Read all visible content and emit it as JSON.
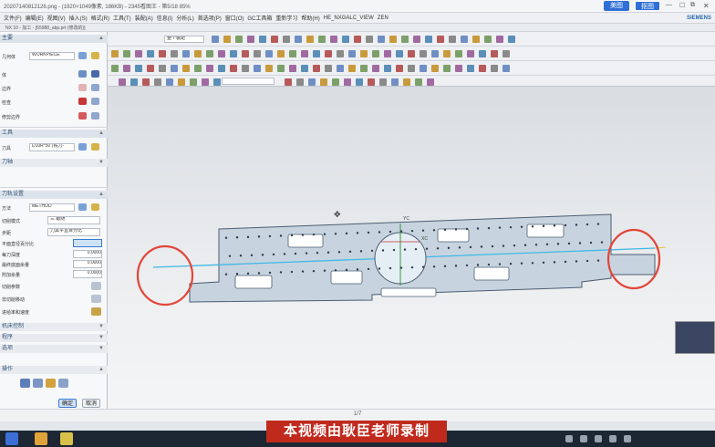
{
  "titlebar": {
    "text": "20207140812126.png - (1920×1049像素, 186KB) - 2345看图王 - 第5/18 85%",
    "btn_beautify": "美图",
    "btn_cutout": "抠图",
    "brand": "SIEMENS",
    "accent_color": "#2f6fd6",
    "close_glyph": "✕",
    "min_glyph": "—",
    "max_glyph": "☐",
    "restore_glyph": "⧉"
  },
  "menubar": {
    "items": [
      "文件(F)",
      "编辑(E)",
      "视图(V)",
      "插入(S)",
      "格式(R)",
      "工具(T)",
      "装配(A)",
      "信息(I)",
      "分析(L)",
      "首选项(P)",
      "窗口(O)",
      "GC工具箱",
      "重新学习",
      "帮助(H)",
      "HE_NXGALC_VIEW",
      "ZEN"
    ]
  },
  "statusline": {
    "title": "NX 10 - 加工 - [55988_abp.prt (修改的)]"
  },
  "toolbar": {
    "filter_label": "整个装配"
  },
  "panel": {
    "section1": "主要",
    "geometry_label": "几何体",
    "geometry_value": "WORKPIECE",
    "row_blank1": "体",
    "row_part_boundary": "边界",
    "row_check": "检查",
    "row_trim": "修剪边界",
    "section2": "工具",
    "tool_label": "刀具",
    "tool_value": "D10R*50 (铣刀-",
    "section3": "刀轴",
    "section4": "刀轨设置",
    "method_label": "方法",
    "method_value": "METHOD",
    "cut_mode_label": "切削模式",
    "cut_mode_value": "三 跟随",
    "step_label": "步距",
    "step_value": "刀具平直百分比",
    "pct_label": "平面直径百分比",
    "pct_value": "",
    "depth1_label": "每刀深度",
    "depth1_value": "0.0000",
    "depth2_label": "最终底面余量",
    "depth2_value": "0.0000",
    "depth3_label": "附加余量",
    "depth3_value": "0.0000",
    "row_cut_params": "切削参数",
    "row_noncut": "非切削移动",
    "row_feeds": "进给率和速度",
    "section5": "机床控制",
    "section6": "程序",
    "section7": "选项",
    "section8": "操作",
    "ok_label": "确定",
    "cancel_label": "取消"
  },
  "viewport": {
    "axis_label": "YC",
    "label_small": "XC"
  },
  "bottombar": {
    "page_indicator": "1/7"
  },
  "subtitle": {
    "text": "本视频由耿臣老师录制"
  }
}
